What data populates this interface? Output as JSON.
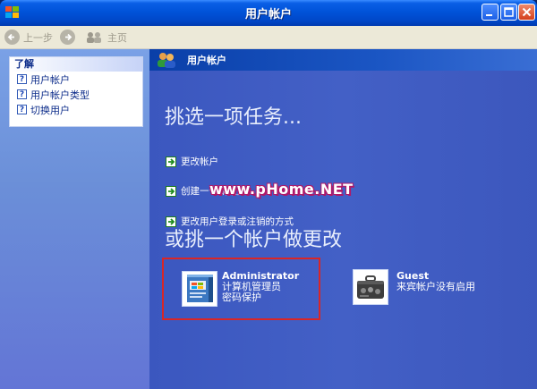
{
  "window": {
    "title": "用户帐户"
  },
  "toolbar": {
    "back_label": "上一步",
    "home_label": "主页"
  },
  "learn": {
    "heading": "了解",
    "items": [
      {
        "label": "用户帐户"
      },
      {
        "label": "用户帐户类型"
      },
      {
        "label": "切换用户"
      }
    ]
  },
  "main": {
    "header_title": "用户帐户",
    "task_heading": "挑选一项任务...",
    "tasks": [
      {
        "label": "更改帐户"
      },
      {
        "label": "创建一个新帐户"
      },
      {
        "label": "更改用户登录或注销的方式"
      }
    ],
    "account_heading": "或挑一个帐户做更改",
    "watermark": "www.pHome.NET",
    "accounts": [
      {
        "name": "Administrator",
        "line1": "计算机管理员",
        "line2": "密码保护",
        "picture": "windows-box-picture"
      },
      {
        "name": "Guest",
        "line1": "来宾帐户没有启用",
        "picture": "suitcase-picture"
      }
    ]
  },
  "colors": {
    "title_bar": "#0053d9",
    "left_pane": "#6b8fd8",
    "main_pane": "#4360c6",
    "highlight_border": "#d92626",
    "watermark_outline": "#b01868"
  }
}
